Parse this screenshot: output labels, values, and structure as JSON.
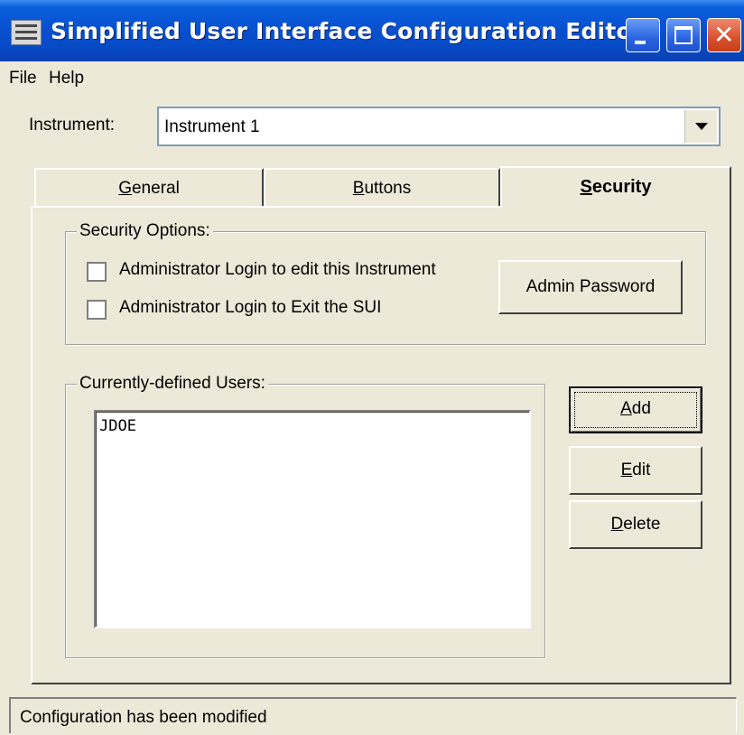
{
  "window": {
    "title": "Simplified User Interface Configuration Editor"
  },
  "menu": {
    "file": "File",
    "help": "Help"
  },
  "instrument": {
    "label": "Instrument:",
    "selected": "Instrument 1"
  },
  "tabs": {
    "general": {
      "first": "G",
      "rest": "eneral"
    },
    "buttons": {
      "first": "B",
      "rest": "uttons"
    },
    "security": {
      "first": "S",
      "rest": "ecurity"
    },
    "active": "Security"
  },
  "security_options": {
    "legend": "Security Options:",
    "checkbox_edit_label": "Administrator Login to edit this Instrument",
    "checkbox_edit_checked": false,
    "checkbox_exit_label": "Administrator Login to Exit the SUI",
    "checkbox_exit_checked": false,
    "admin_password_button": "Admin Password"
  },
  "users": {
    "legend": "Currently-defined Users:",
    "items": [
      "JDOE"
    ],
    "add_button": {
      "first": "A",
      "rest": "dd"
    },
    "edit_button": {
      "first": "E",
      "rest": "dit"
    },
    "delete_button": {
      "first": "D",
      "rest": "elete"
    }
  },
  "status": {
    "text": "Configuration has been modified"
  },
  "colors": {
    "titlebar": "#0a5fdd",
    "face": "#ece9d8",
    "close": "#d8502c"
  },
  "icons": {
    "system_menu": "window-menu-icon",
    "minimize": "minimize-icon",
    "maximize": "maximize-icon",
    "close": "close-icon",
    "combo_arrow": "chevron-down-icon"
  }
}
